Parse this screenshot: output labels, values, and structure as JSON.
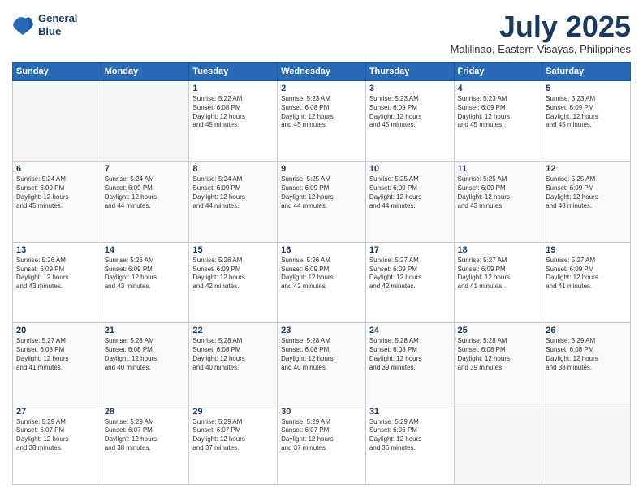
{
  "header": {
    "logo_line1": "General",
    "logo_line2": "Blue",
    "month": "July 2025",
    "location": "Malilinao, Eastern Visayas, Philippines"
  },
  "days_of_week": [
    "Sunday",
    "Monday",
    "Tuesday",
    "Wednesday",
    "Thursday",
    "Friday",
    "Saturday"
  ],
  "weeks": [
    [
      {
        "num": "",
        "info": ""
      },
      {
        "num": "",
        "info": ""
      },
      {
        "num": "1",
        "info": "Sunrise: 5:22 AM\nSunset: 6:08 PM\nDaylight: 12 hours\nand 45 minutes."
      },
      {
        "num": "2",
        "info": "Sunrise: 5:23 AM\nSunset: 6:08 PM\nDaylight: 12 hours\nand 45 minutes."
      },
      {
        "num": "3",
        "info": "Sunrise: 5:23 AM\nSunset: 6:09 PM\nDaylight: 12 hours\nand 45 minutes."
      },
      {
        "num": "4",
        "info": "Sunrise: 5:23 AM\nSunset: 6:09 PM\nDaylight: 12 hours\nand 45 minutes."
      },
      {
        "num": "5",
        "info": "Sunrise: 5:23 AM\nSunset: 6:09 PM\nDaylight: 12 hours\nand 45 minutes."
      }
    ],
    [
      {
        "num": "6",
        "info": "Sunrise: 5:24 AM\nSunset: 6:09 PM\nDaylight: 12 hours\nand 45 minutes."
      },
      {
        "num": "7",
        "info": "Sunrise: 5:24 AM\nSunset: 6:09 PM\nDaylight: 12 hours\nand 44 minutes."
      },
      {
        "num": "8",
        "info": "Sunrise: 5:24 AM\nSunset: 6:09 PM\nDaylight: 12 hours\nand 44 minutes."
      },
      {
        "num": "9",
        "info": "Sunrise: 5:25 AM\nSunset: 6:09 PM\nDaylight: 12 hours\nand 44 minutes."
      },
      {
        "num": "10",
        "info": "Sunrise: 5:25 AM\nSunset: 6:09 PM\nDaylight: 12 hours\nand 44 minutes."
      },
      {
        "num": "11",
        "info": "Sunrise: 5:25 AM\nSunset: 6:09 PM\nDaylight: 12 hours\nand 43 minutes."
      },
      {
        "num": "12",
        "info": "Sunrise: 5:25 AM\nSunset: 6:09 PM\nDaylight: 12 hours\nand 43 minutes."
      }
    ],
    [
      {
        "num": "13",
        "info": "Sunrise: 5:26 AM\nSunset: 6:09 PM\nDaylight: 12 hours\nand 43 minutes."
      },
      {
        "num": "14",
        "info": "Sunrise: 5:26 AM\nSunset: 6:09 PM\nDaylight: 12 hours\nand 43 minutes."
      },
      {
        "num": "15",
        "info": "Sunrise: 5:26 AM\nSunset: 6:09 PM\nDaylight: 12 hours\nand 42 minutes."
      },
      {
        "num": "16",
        "info": "Sunrise: 5:26 AM\nSunset: 6:09 PM\nDaylight: 12 hours\nand 42 minutes."
      },
      {
        "num": "17",
        "info": "Sunrise: 5:27 AM\nSunset: 6:09 PM\nDaylight: 12 hours\nand 42 minutes."
      },
      {
        "num": "18",
        "info": "Sunrise: 5:27 AM\nSunset: 6:09 PM\nDaylight: 12 hours\nand 41 minutes."
      },
      {
        "num": "19",
        "info": "Sunrise: 5:27 AM\nSunset: 6:09 PM\nDaylight: 12 hours\nand 41 minutes."
      }
    ],
    [
      {
        "num": "20",
        "info": "Sunrise: 5:27 AM\nSunset: 6:08 PM\nDaylight: 12 hours\nand 41 minutes."
      },
      {
        "num": "21",
        "info": "Sunrise: 5:28 AM\nSunset: 6:08 PM\nDaylight: 12 hours\nand 40 minutes."
      },
      {
        "num": "22",
        "info": "Sunrise: 5:28 AM\nSunset: 6:08 PM\nDaylight: 12 hours\nand 40 minutes."
      },
      {
        "num": "23",
        "info": "Sunrise: 5:28 AM\nSunset: 6:08 PM\nDaylight: 12 hours\nand 40 minutes."
      },
      {
        "num": "24",
        "info": "Sunrise: 5:28 AM\nSunset: 6:08 PM\nDaylight: 12 hours\nand 39 minutes."
      },
      {
        "num": "25",
        "info": "Sunrise: 5:28 AM\nSunset: 6:08 PM\nDaylight: 12 hours\nand 39 minutes."
      },
      {
        "num": "26",
        "info": "Sunrise: 5:29 AM\nSunset: 6:08 PM\nDaylight: 12 hours\nand 38 minutes."
      }
    ],
    [
      {
        "num": "27",
        "info": "Sunrise: 5:29 AM\nSunset: 6:07 PM\nDaylight: 12 hours\nand 38 minutes."
      },
      {
        "num": "28",
        "info": "Sunrise: 5:29 AM\nSunset: 6:07 PM\nDaylight: 12 hours\nand 38 minutes."
      },
      {
        "num": "29",
        "info": "Sunrise: 5:29 AM\nSunset: 6:07 PM\nDaylight: 12 hours\nand 37 minutes."
      },
      {
        "num": "30",
        "info": "Sunrise: 5:29 AM\nSunset: 6:07 PM\nDaylight: 12 hours\nand 37 minutes."
      },
      {
        "num": "31",
        "info": "Sunrise: 5:29 AM\nSunset: 6:06 PM\nDaylight: 12 hours\nand 36 minutes."
      },
      {
        "num": "",
        "info": ""
      },
      {
        "num": "",
        "info": ""
      }
    ]
  ]
}
